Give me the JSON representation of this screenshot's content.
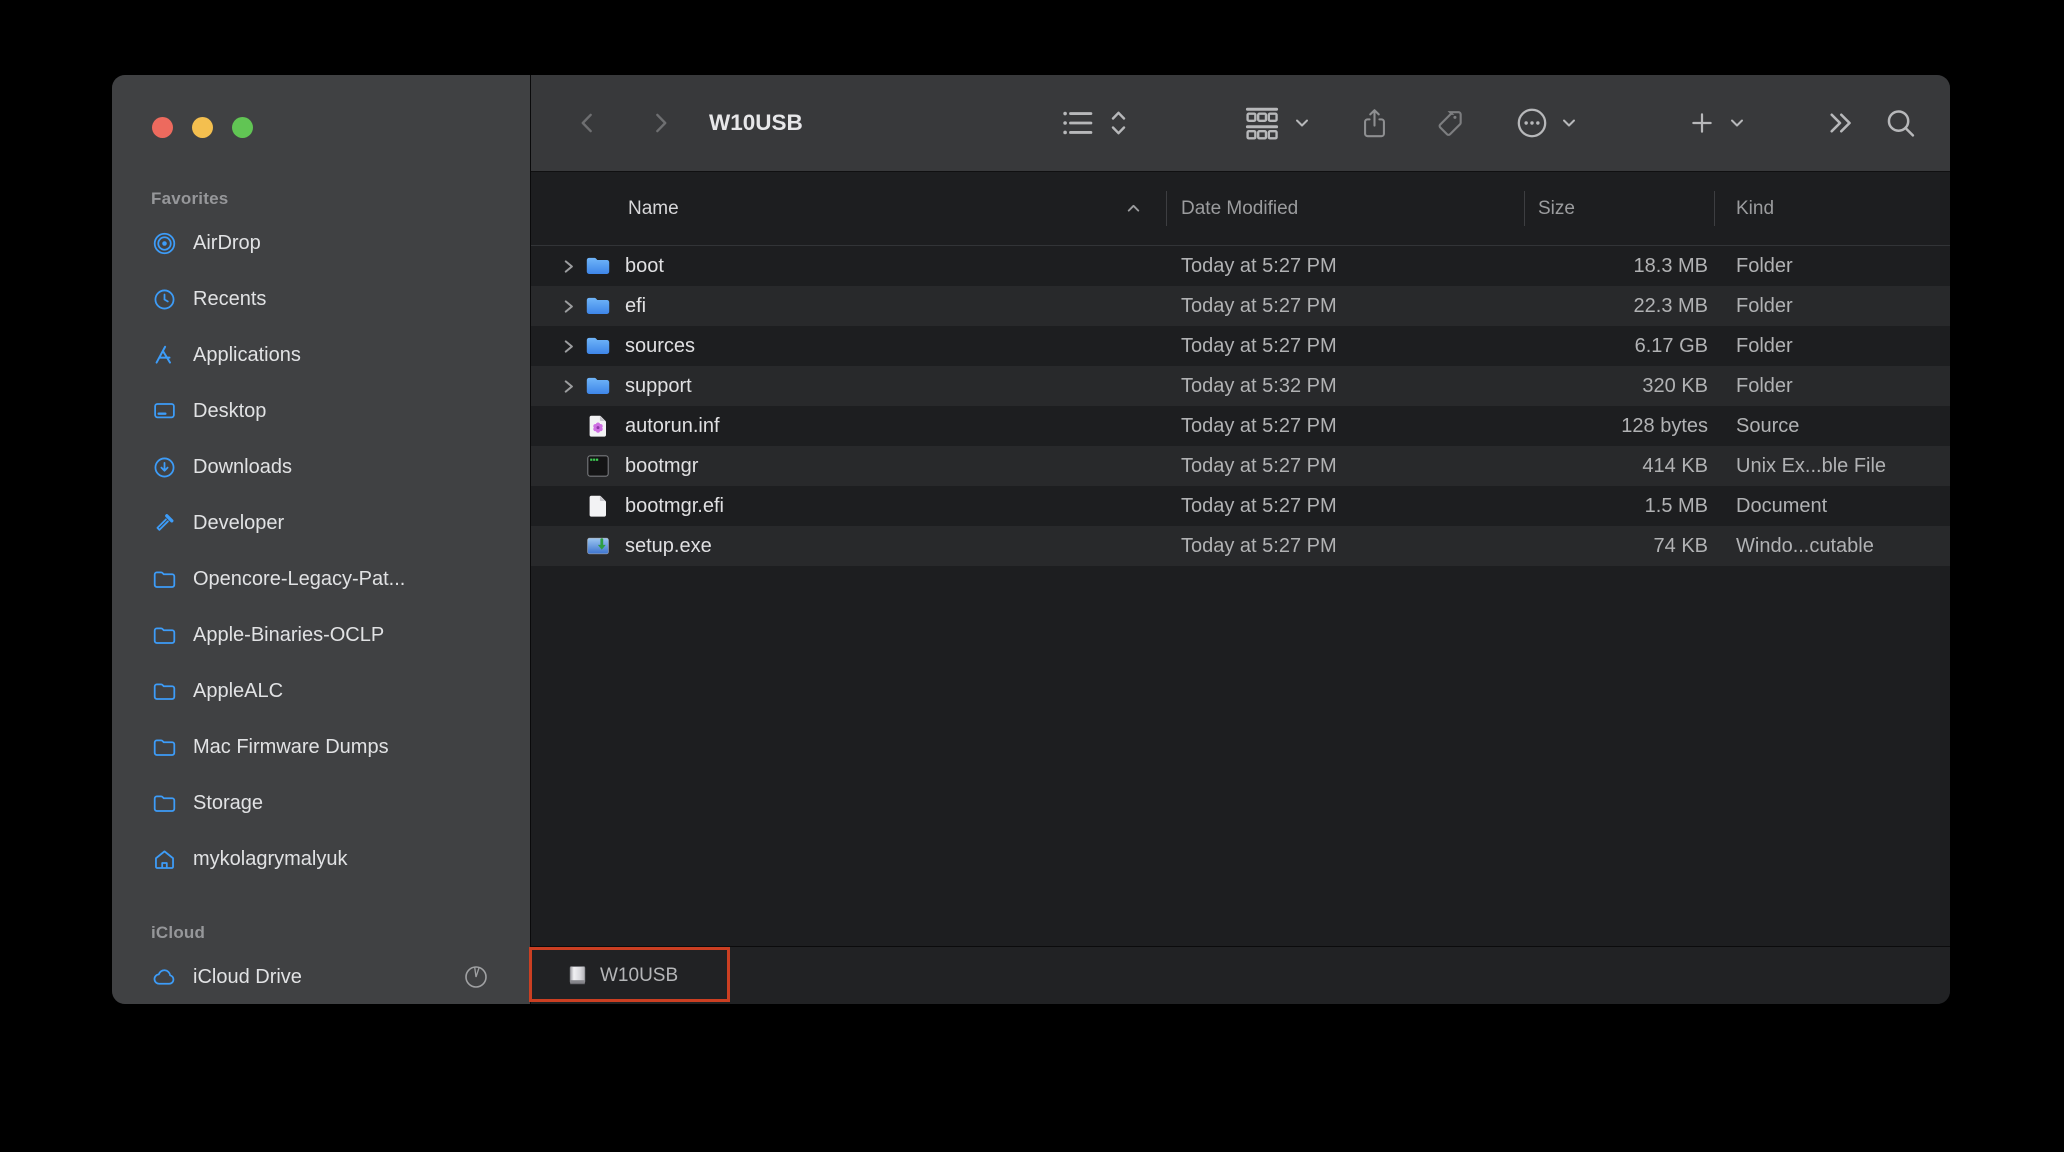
{
  "window": {
    "title": "W10USB"
  },
  "window_controls": {
    "close": "close-button",
    "minimize": "minimize-button",
    "zoom": "zoom-button"
  },
  "sidebar": {
    "sections": [
      {
        "label": "Favorites",
        "items": [
          {
            "icon": "airdrop-icon",
            "label": "AirDrop"
          },
          {
            "icon": "clock-icon",
            "label": "Recents"
          },
          {
            "icon": "app-store-icon",
            "label": "Applications"
          },
          {
            "icon": "desktop-icon",
            "label": "Desktop"
          },
          {
            "icon": "downloads-circle-icon",
            "label": "Downloads"
          },
          {
            "icon": "hammer-icon",
            "label": "Developer"
          },
          {
            "icon": "folder-icon",
            "label": "Opencore-Legacy-Pat..."
          },
          {
            "icon": "folder-icon",
            "label": "Apple-Binaries-OCLP"
          },
          {
            "icon": "folder-icon",
            "label": "AppleALC"
          },
          {
            "icon": "folder-icon",
            "label": "Mac Firmware Dumps"
          },
          {
            "icon": "folder-icon",
            "label": "Storage"
          },
          {
            "icon": "home-icon",
            "label": "mykolagrymalyuk"
          }
        ]
      },
      {
        "label": "iCloud",
        "items": [
          {
            "icon": "cloud-icon",
            "label": "iCloud Drive",
            "trailing": "sync-progress-ring"
          }
        ]
      }
    ]
  },
  "toolbar": {
    "back": "chevron-left-icon",
    "forward": "chevron-right-icon",
    "buttons": [
      "view-selector",
      "group-by",
      "share",
      "tag",
      "more-actions",
      "add-new",
      "overflow",
      "search"
    ]
  },
  "list": {
    "columns": [
      {
        "label": "Name",
        "sort": "ascending"
      },
      {
        "label": "Date Modified"
      },
      {
        "label": "Size"
      },
      {
        "label": "Kind"
      }
    ],
    "rows": [
      {
        "name": "boot",
        "icon": "folder",
        "expandable": true,
        "date": "Today at 5:27 PM",
        "size": "18.3 MB",
        "kind": "Folder"
      },
      {
        "name": "efi",
        "icon": "folder",
        "expandable": true,
        "date": "Today at 5:27 PM",
        "size": "22.3 MB",
        "kind": "Folder"
      },
      {
        "name": "sources",
        "icon": "folder",
        "expandable": true,
        "date": "Today at 5:27 PM",
        "size": "6.17 GB",
        "kind": "Folder"
      },
      {
        "name": "support",
        "icon": "folder",
        "expandable": true,
        "date": "Today at 5:32 PM",
        "size": "320 KB",
        "kind": "Folder"
      },
      {
        "name": "autorun.inf",
        "icon": "source-file",
        "expandable": false,
        "date": "Today at 5:27 PM",
        "size": "128 bytes",
        "kind": "Source"
      },
      {
        "name": "bootmgr",
        "icon": "unix-executable",
        "expandable": false,
        "date": "Today at 5:27 PM",
        "size": "414 KB",
        "kind": "Unix Ex...ble File"
      },
      {
        "name": "bootmgr.efi",
        "icon": "document",
        "expandable": false,
        "date": "Today at 5:27 PM",
        "size": "1.5 MB",
        "kind": "Document"
      },
      {
        "name": "setup.exe",
        "icon": "windows-executable",
        "expandable": false,
        "date": "Today at 5:27 PM",
        "size": "74 KB",
        "kind": "Windo...cutable"
      }
    ]
  },
  "path_bar": {
    "items": [
      {
        "icon": "external-disk-icon",
        "label": "W10USB",
        "annotated": true
      }
    ]
  },
  "colors": {
    "accent_blue": "#3d9cf8",
    "folder_blue_top": "#6fb4f8",
    "folder_blue_bottom": "#3e86e9",
    "annotation_red": "#cb3f22",
    "traffic_red": "#ed6a5e",
    "traffic_yellow": "#f4bf4f",
    "traffic_green": "#61c554"
  }
}
